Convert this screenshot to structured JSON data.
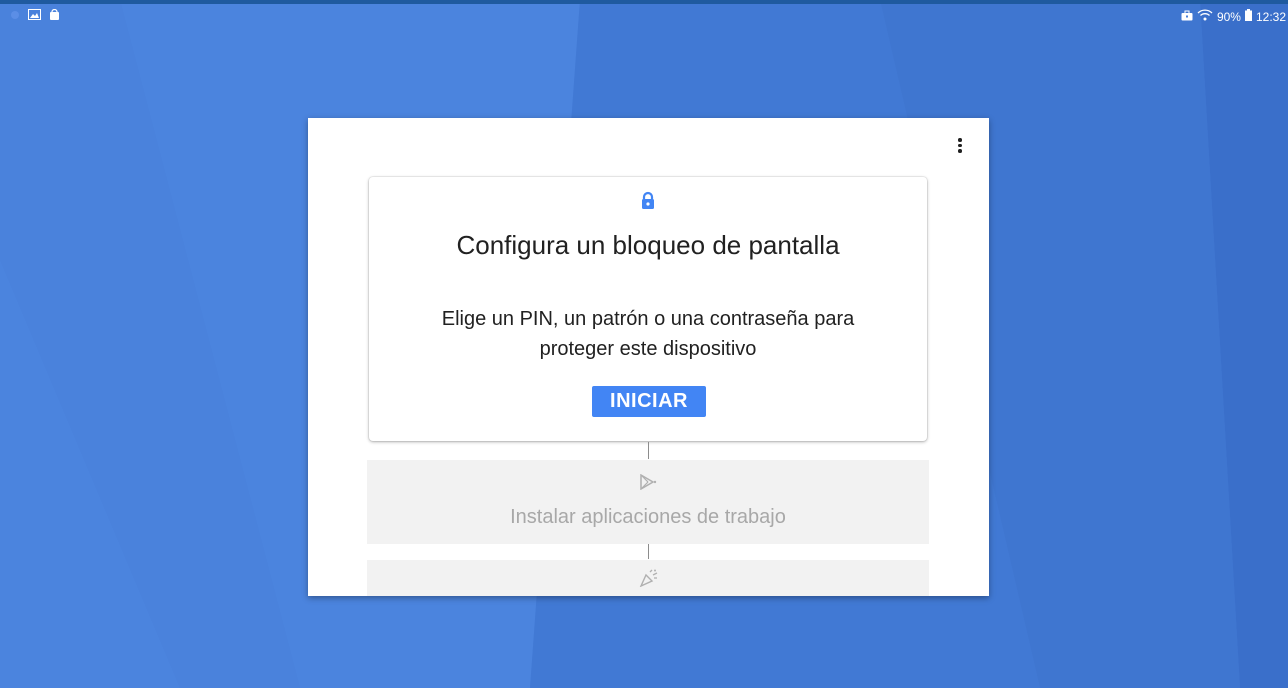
{
  "status_bar": {
    "left_icons": [
      "status-dot-icon",
      "gallery-icon",
      "shopping-bag-icon"
    ],
    "right_icons": [
      "briefcase-icon",
      "wifi-icon",
      "battery-icon"
    ],
    "battery": "90%",
    "time": "12:32"
  },
  "dialog": {
    "menu_icon": "more-vert-icon",
    "active_step": {
      "icon": "lock-icon",
      "title": "Configura un bloqueo de pantalla",
      "description": "Elige un PIN, un patrón o una contraseña para proteger este dispositivo",
      "button_label": "INICIAR"
    },
    "steps": [
      {
        "icon": "play-store-icon",
        "label": "Instalar aplicaciones de trabajo"
      },
      {
        "icon": "party-popper-icon",
        "label": ""
      }
    ]
  },
  "colors": {
    "wallpaper": "#4a7fd8",
    "accent": "#4285f4",
    "inactive_text": "#a8a8a8"
  }
}
